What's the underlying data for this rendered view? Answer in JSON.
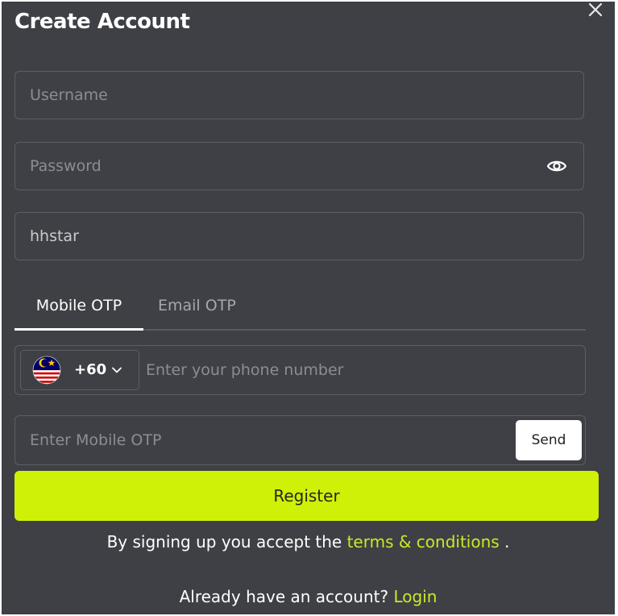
{
  "modal": {
    "title": "Create Account",
    "close_icon": "close-icon"
  },
  "form": {
    "username": {
      "placeholder": "Username",
      "value": ""
    },
    "password": {
      "placeholder": "Password",
      "value": "",
      "toggle_icon": "eye-icon"
    },
    "referral": {
      "placeholder": "",
      "value": "hhstar"
    }
  },
  "tabs": [
    {
      "label": "Mobile OTP",
      "active": true
    },
    {
      "label": "Email OTP",
      "active": false
    }
  ],
  "phone": {
    "country_flag": "malaysia-flag-icon",
    "dial_code": "+60",
    "chevron_icon": "chevron-down-icon",
    "placeholder": "Enter your phone number"
  },
  "otp": {
    "placeholder": "Enter Mobile OTP",
    "send_label": "Send"
  },
  "register_label": "Register",
  "terms": {
    "prefix": "By signing up you accept the ",
    "link": "terms & conditions",
    "suffix": " ."
  },
  "login": {
    "prefix": "Already have an account? ",
    "link": "Login"
  },
  "colors": {
    "modal_bg": "#3f4045",
    "accent": "#cff108",
    "link": "#c5eb2a",
    "border": "#5d5e64"
  }
}
